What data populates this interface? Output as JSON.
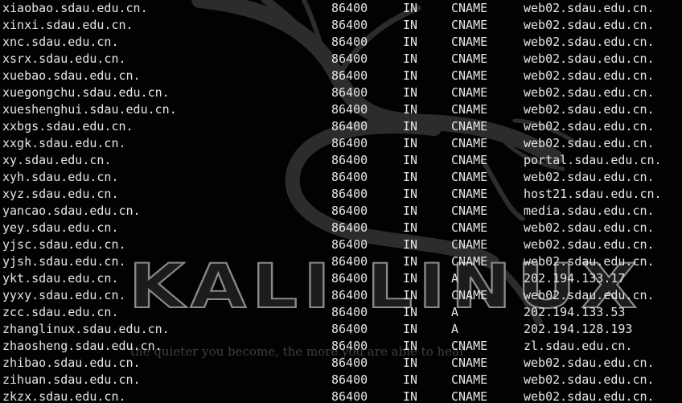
{
  "wallpaper": {
    "brand": "KALI LINUX",
    "tagline": "the quieter you become, the more you are able to hear"
  },
  "records": [
    {
      "name": "xiaobao.sdau.edu.cn.",
      "ttl": "86400",
      "class": "IN",
      "type": "CNAME",
      "data": "web02.sdau.edu.cn."
    },
    {
      "name": "xinxi.sdau.edu.cn.",
      "ttl": "86400",
      "class": "IN",
      "type": "CNAME",
      "data": "web02.sdau.edu.cn."
    },
    {
      "name": "xnc.sdau.edu.cn.",
      "ttl": "86400",
      "class": "IN",
      "type": "CNAME",
      "data": "web02.sdau.edu.cn."
    },
    {
      "name": "xsrx.sdau.edu.cn.",
      "ttl": "86400",
      "class": "IN",
      "type": "CNAME",
      "data": "web02.sdau.edu.cn."
    },
    {
      "name": "xuebao.sdau.edu.cn.",
      "ttl": "86400",
      "class": "IN",
      "type": "CNAME",
      "data": "web02.sdau.edu.cn."
    },
    {
      "name": "xuegongchu.sdau.edu.cn.",
      "ttl": "86400",
      "class": "IN",
      "type": "CNAME",
      "data": "web02.sdau.edu.cn."
    },
    {
      "name": "xueshenghui.sdau.edu.cn.",
      "ttl": "86400",
      "class": "IN",
      "type": "CNAME",
      "data": "web02.sdau.edu.cn."
    },
    {
      "name": "xxbgs.sdau.edu.cn.",
      "ttl": "86400",
      "class": "IN",
      "type": "CNAME",
      "data": "web02.sdau.edu.cn."
    },
    {
      "name": "xxgk.sdau.edu.cn.",
      "ttl": "86400",
      "class": "IN",
      "type": "CNAME",
      "data": "web02.sdau.edu.cn."
    },
    {
      "name": "xy.sdau.edu.cn.",
      "ttl": "86400",
      "class": "IN",
      "type": "CNAME",
      "data": "portal.sdau.edu.cn."
    },
    {
      "name": "xyh.sdau.edu.cn.",
      "ttl": "86400",
      "class": "IN",
      "type": "CNAME",
      "data": "web02.sdau.edu.cn."
    },
    {
      "name": "xyz.sdau.edu.cn.",
      "ttl": "86400",
      "class": "IN",
      "type": "CNAME",
      "data": "host21.sdau.edu.cn."
    },
    {
      "name": "yancao.sdau.edu.cn.",
      "ttl": "86400",
      "class": "IN",
      "type": "CNAME",
      "data": "media.sdau.edu.cn."
    },
    {
      "name": "yey.sdau.edu.cn.",
      "ttl": "86400",
      "class": "IN",
      "type": "CNAME",
      "data": "web02.sdau.edu.cn."
    },
    {
      "name": "yjsc.sdau.edu.cn.",
      "ttl": "86400",
      "class": "IN",
      "type": "CNAME",
      "data": "web02.sdau.edu.cn."
    },
    {
      "name": "yjsh.sdau.edu.cn.",
      "ttl": "86400",
      "class": "IN",
      "type": "CNAME",
      "data": "web02.sdau.edu.cn."
    },
    {
      "name": "ykt.sdau.edu.cn.",
      "ttl": "86400",
      "class": "IN",
      "type": "A",
      "data": "202.194.133.17"
    },
    {
      "name": "yyxy.sdau.edu.cn.",
      "ttl": "86400",
      "class": "IN",
      "type": "CNAME",
      "data": "web02.sdau.edu.cn."
    },
    {
      "name": "zcc.sdau.edu.cn.",
      "ttl": "86400",
      "class": "IN",
      "type": "A",
      "data": "202.194.133.53"
    },
    {
      "name": "zhanglinux.sdau.edu.cn.",
      "ttl": "86400",
      "class": "IN",
      "type": "A",
      "data": "202.194.128.193"
    },
    {
      "name": "zhaosheng.sdau.edu.cn.",
      "ttl": "86400",
      "class": "IN",
      "type": "CNAME",
      "data": "zl.sdau.edu.cn."
    },
    {
      "name": "zhibao.sdau.edu.cn.",
      "ttl": "86400",
      "class": "IN",
      "type": "CNAME",
      "data": "web02.sdau.edu.cn."
    },
    {
      "name": "zihuan.sdau.edu.cn.",
      "ttl": "86400",
      "class": "IN",
      "type": "CNAME",
      "data": "web02.sdau.edu.cn."
    },
    {
      "name": "zkzx.sdau.edu.cn.",
      "ttl": "86400",
      "class": "IN",
      "type": "CNAME",
      "data": "web02.sdau.edu.cn."
    }
  ]
}
